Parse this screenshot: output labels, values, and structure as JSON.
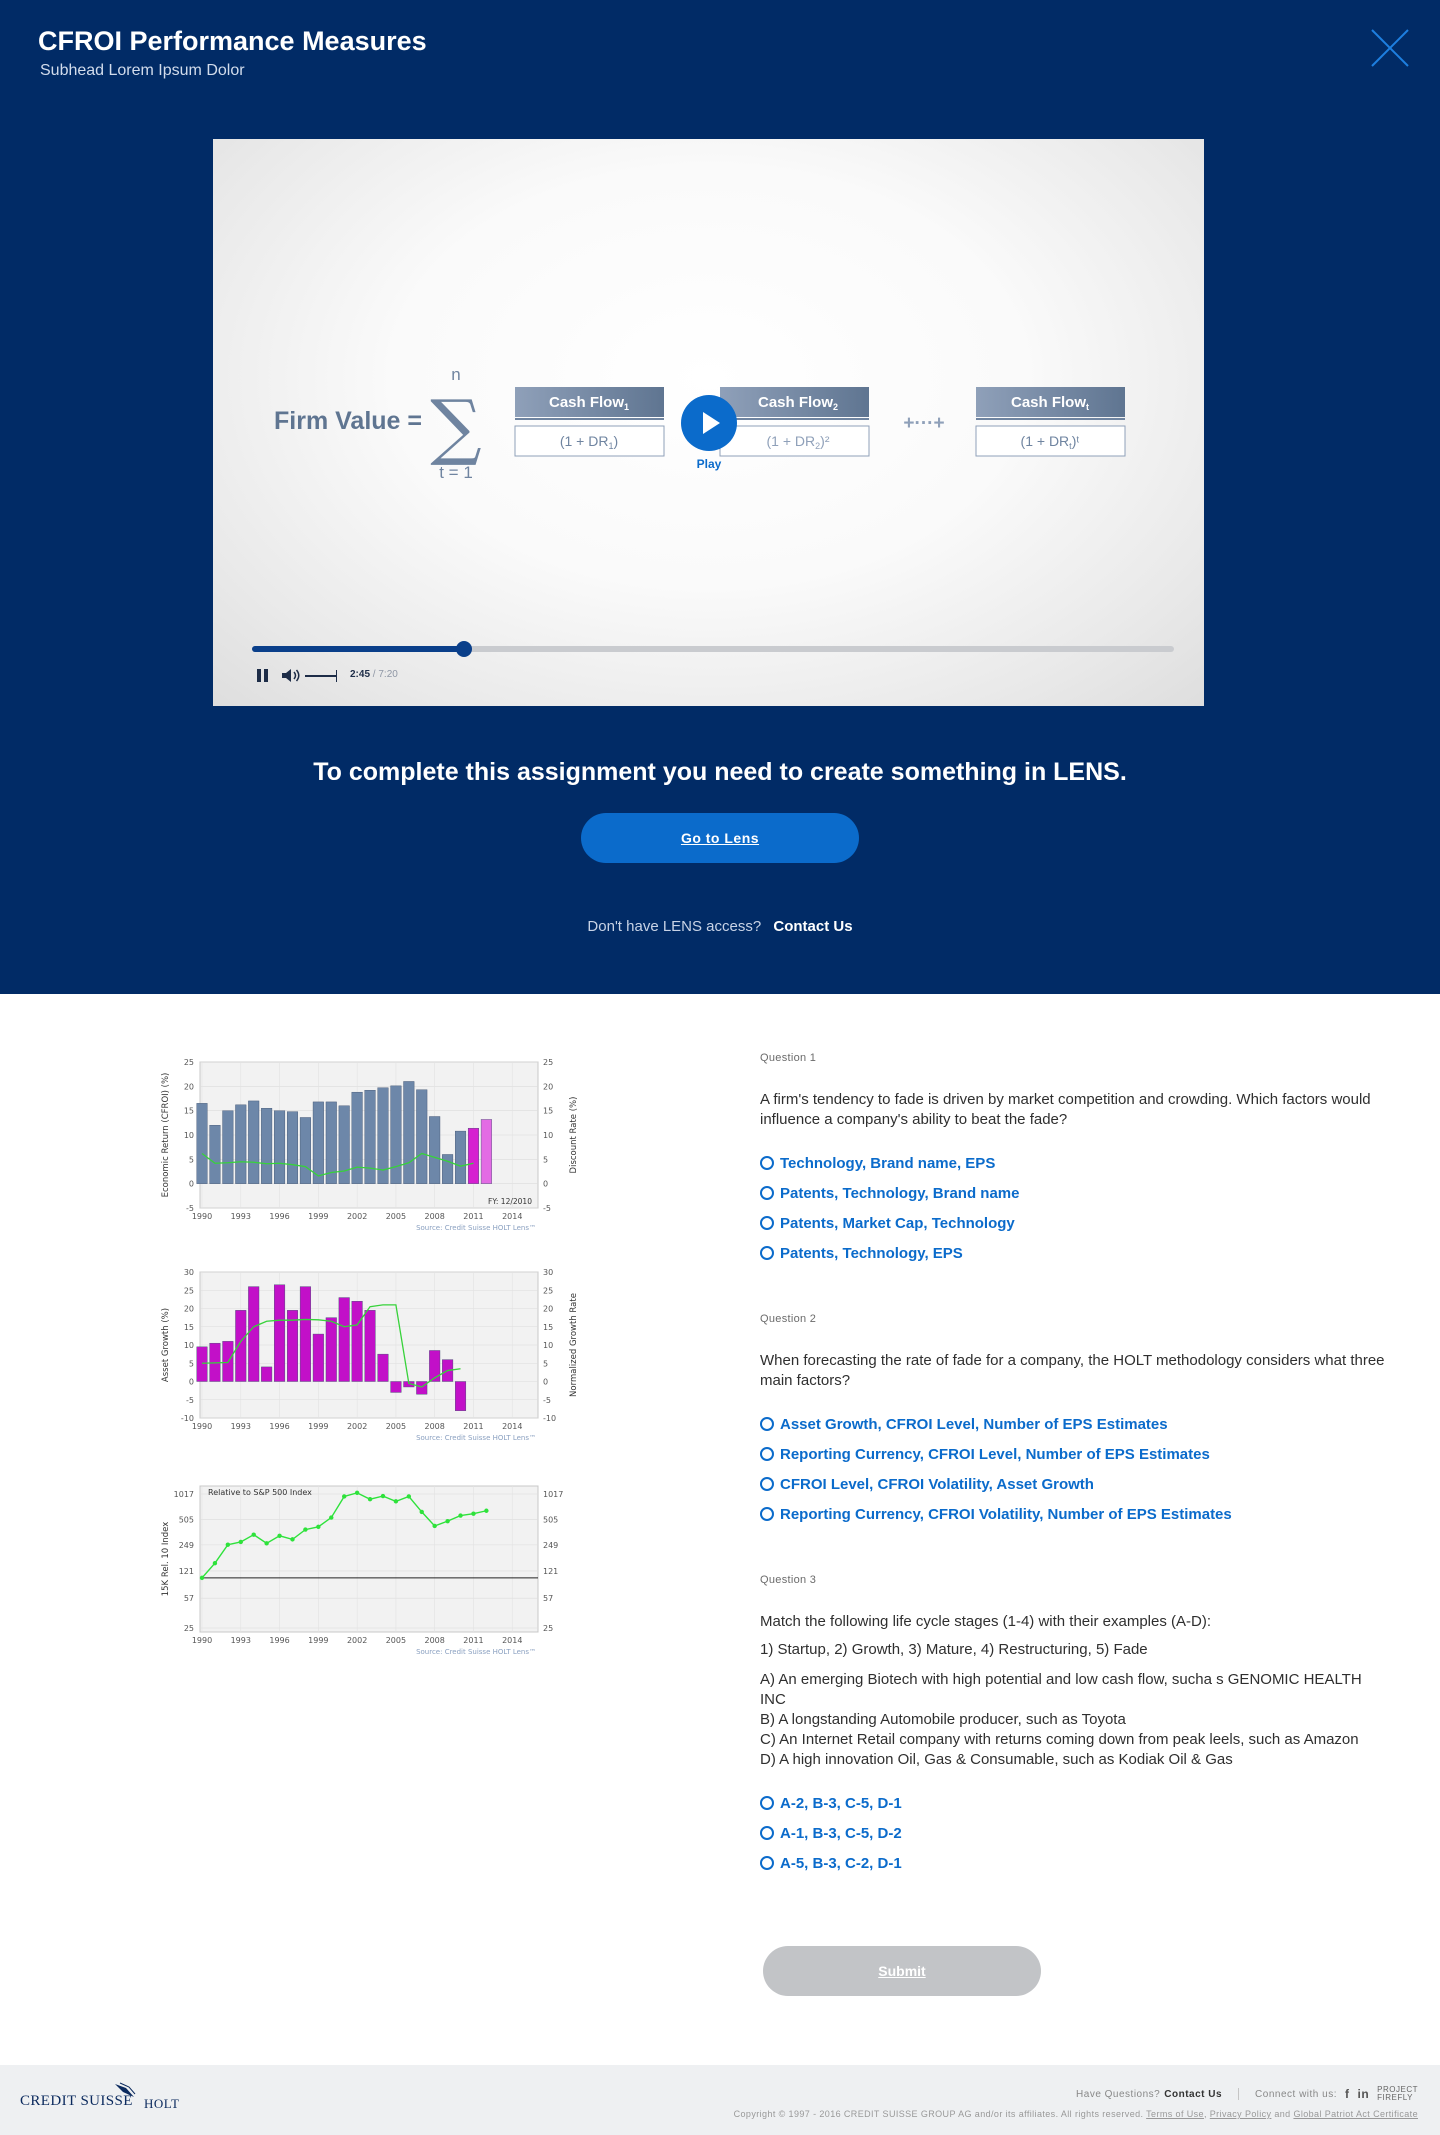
{
  "header": {
    "title": "CFROI Performance Measures",
    "subtitle": "Subhead Lorem Ipsum Dolor"
  },
  "video": {
    "formula": {
      "firm_value": "Firm Value =",
      "sum_upper": "n",
      "sum_lower": "t = 1",
      "term1_num": "Cash Flow",
      "term1_num_sub": "1",
      "term1_den": "(1 + DR",
      "term1_den_sub": "1",
      "term1_den_end": ")",
      "term2_num": "Cash Flow",
      "term2_num_sub": "2",
      "term2_den": "(1 + DR",
      "term2_den_sub": "2",
      "term2_den_end": ")²",
      "ellipsis": "+···+",
      "term3_num": "Cash Flow",
      "term3_num_sub": "t",
      "term3_den": "(1 + DR",
      "term3_den_sub": "t",
      "term3_den_end": ")ᵗ"
    },
    "play_label": "Play",
    "current_time": "2:45",
    "time_separator": "/",
    "duration": "7:20",
    "progress_fraction": 0.23
  },
  "assignment": {
    "message": "To complete this assignment you need to create something in LENS.",
    "button_label": "Go to Lens",
    "access_prompt": "Don't have LENS access?",
    "contact_label": "Contact Us"
  },
  "charts": {
    "source": "Source: Credit Suisse HOLT Lens™",
    "x_ticks": [
      "1990",
      "1993",
      "1996",
      "1999",
      "2002",
      "2005",
      "2008",
      "2011",
      "2014"
    ]
  },
  "chart_data": [
    {
      "type": "bar",
      "ylabel": "Economic Return (CFROI) (%)",
      "y2label": "Discount Rate (%)",
      "ylim": [
        -5,
        25
      ],
      "y_ticks": [
        "25",
        "20",
        "15",
        "10",
        "5",
        "0",
        "-5"
      ],
      "annotation": "FY: 12/2010",
      "x": [
        1990,
        1991,
        1992,
        1993,
        1994,
        1995,
        1996,
        1997,
        1998,
        1999,
        2000,
        2001,
        2002,
        2003,
        2004,
        2005,
        2006,
        2007,
        2008,
        2009,
        2010,
        2011
      ],
      "bars": [
        16.5,
        12,
        15,
        16.2,
        17,
        15.5,
        15,
        14.8,
        13.6,
        16.8,
        16.8,
        16,
        18.8,
        19.2,
        19.7,
        20.1,
        21,
        19.3,
        13.8,
        6,
        10.8,
        11.4,
        13.2
      ],
      "bar_colors": [
        "#6d87a9",
        "#6d87a9",
        "#6d87a9",
        "#6d87a9",
        "#6d87a9",
        "#6d87a9",
        "#6d87a9",
        "#6d87a9",
        "#6d87a9",
        "#6d87a9",
        "#6d87a9",
        "#6d87a9",
        "#6d87a9",
        "#6d87a9",
        "#6d87a9",
        "#6d87a9",
        "#6d87a9",
        "#6d87a9",
        "#6d87a9",
        "#6d87a9",
        "#6d87a9",
        "#d61fd0",
        "#e36be4"
      ],
      "line": [
        6.2,
        4.2,
        4.3,
        4.5,
        4.4,
        4.1,
        4.2,
        3.9,
        3.5,
        1.6,
        2.3,
        2.6,
        3.4,
        3.2,
        2.8,
        3.5,
        4.3,
        6.2,
        5.4,
        4.6,
        3.6,
        4.2
      ]
    },
    {
      "type": "bar",
      "ylabel": "Asset Growth (%)",
      "y2label": "Normalized Growth Rate",
      "ylim": [
        -10,
        30
      ],
      "y_ticks": [
        "30",
        "25",
        "20",
        "15",
        "10",
        "5",
        "0",
        "-5",
        "-10"
      ],
      "x": [
        1990,
        1991,
        1992,
        1993,
        1994,
        1995,
        1996,
        1997,
        1998,
        1999,
        2000,
        2001,
        2002,
        2003,
        2004,
        2005,
        2006,
        2007,
        2008,
        2009,
        2010
      ],
      "bars": [
        9.5,
        10.5,
        11,
        19.5,
        26,
        4,
        26.5,
        19.5,
        26,
        13,
        17.5,
        23,
        22,
        19.5,
        7.5,
        -3,
        -1.5,
        -3.5,
        8.5,
        6,
        -8
      ],
      "bar_color": "#c210c8",
      "line": [
        5,
        5.1,
        5.2,
        11,
        15,
        16.5,
        16.8,
        16.8,
        17,
        16.9,
        16.5,
        15,
        15.5,
        20.5,
        21,
        21,
        -0.5,
        -1.5,
        1,
        3,
        3.5
      ]
    },
    {
      "type": "line",
      "title": "Relative to S&P 500 Index",
      "ylabel": "15K Rel. 10 Index",
      "scale": "log",
      "y_ticks": [
        "1017",
        "505",
        "249",
        "121",
        "57",
        "25"
      ],
      "baseline": 100,
      "x": [
        1990,
        1991,
        1992,
        1993,
        1994,
        1995,
        1996,
        1997,
        1998,
        1999,
        2000,
        2001,
        2002,
        2003,
        2004,
        2005,
        2006,
        2007,
        2008,
        2009,
        2010,
        2011,
        2012
      ],
      "values": [
        100,
        150,
        250,
        270,
        330,
        260,
        320,
        290,
        380,
        410,
        530,
        950,
        1050,
        880,
        960,
        830,
        950,
        620,
        420,
        480,
        560,
        590,
        640
      ]
    }
  ],
  "questions": [
    {
      "label": "Question 1",
      "text": "A firm's tendency to fade is driven by market competition and crowding. Which factors would influence a company's ability to beat the fade?",
      "options": [
        "Technology, Brand name, EPS",
        "Patents, Technology, Brand name",
        "Patents, Market Cap, Technology",
        "Patents, Technology, EPS"
      ]
    },
    {
      "label": "Question 2",
      "text": "When forecasting the rate of fade for a company, the HOLT methodology considers what three main factors?",
      "options": [
        "Asset Growth, CFROI Level, Number of EPS Estimates",
        "Reporting Currency, CFROI Level, Number of EPS Estimates",
        "CFROI Level, CFROI Volatility, Asset Growth",
        "Reporting Currency, CFROI Volatility, Number of EPS Estimates"
      ]
    },
    {
      "label": "Question 3",
      "text": "Match the following life cycle stages (1-4) with their examples (A-D):",
      "stages": "1) Startup, 2) Growth, 3) Mature, 4) Restructuring, 5) Fade",
      "examples": [
        "A) An emerging Biotech with high potential and low cash flow, sucha s GENOMIC HEALTH INC",
        "B) A longstanding Automobile producer, such as Toyota",
        "C) An Internet Retail company with returns coming down from peak leels, such as Amazon",
        "D) A high innovation Oil, Gas & Consumable, such as Kodiak Oil & Gas"
      ],
      "options": [
        "A-2, B-3, C-5, D-1",
        "A-1, B-3, C-5, D-2",
        "A-5, B-3, C-2, D-1"
      ]
    }
  ],
  "submit_label": "Submit",
  "footer": {
    "brand": "CREDIT SUISSE",
    "brand_sub": "HOLT",
    "questions_prompt": "Have Questions?",
    "contact_label": "Contact Us",
    "connect_label": "Connect with us:",
    "facebook": "f",
    "linkedin": "in",
    "fireflies_top": "PROJECT",
    "fireflies_bottom": "FIREFLY",
    "copyright": "Copyright © 1997 - 2016 CREDIT SUISSE GROUP AG and/or its affiliates. All rights reserved.",
    "terms": "Terms of Use",
    "privacy": "Privacy Policy",
    "and_text": "and",
    "patriot": "Global Patriot Act Certificate"
  },
  "colors": {
    "hero_bg": "#012b66",
    "accent": "#0b6bcb",
    "footer_bg": "#eef0f2"
  }
}
